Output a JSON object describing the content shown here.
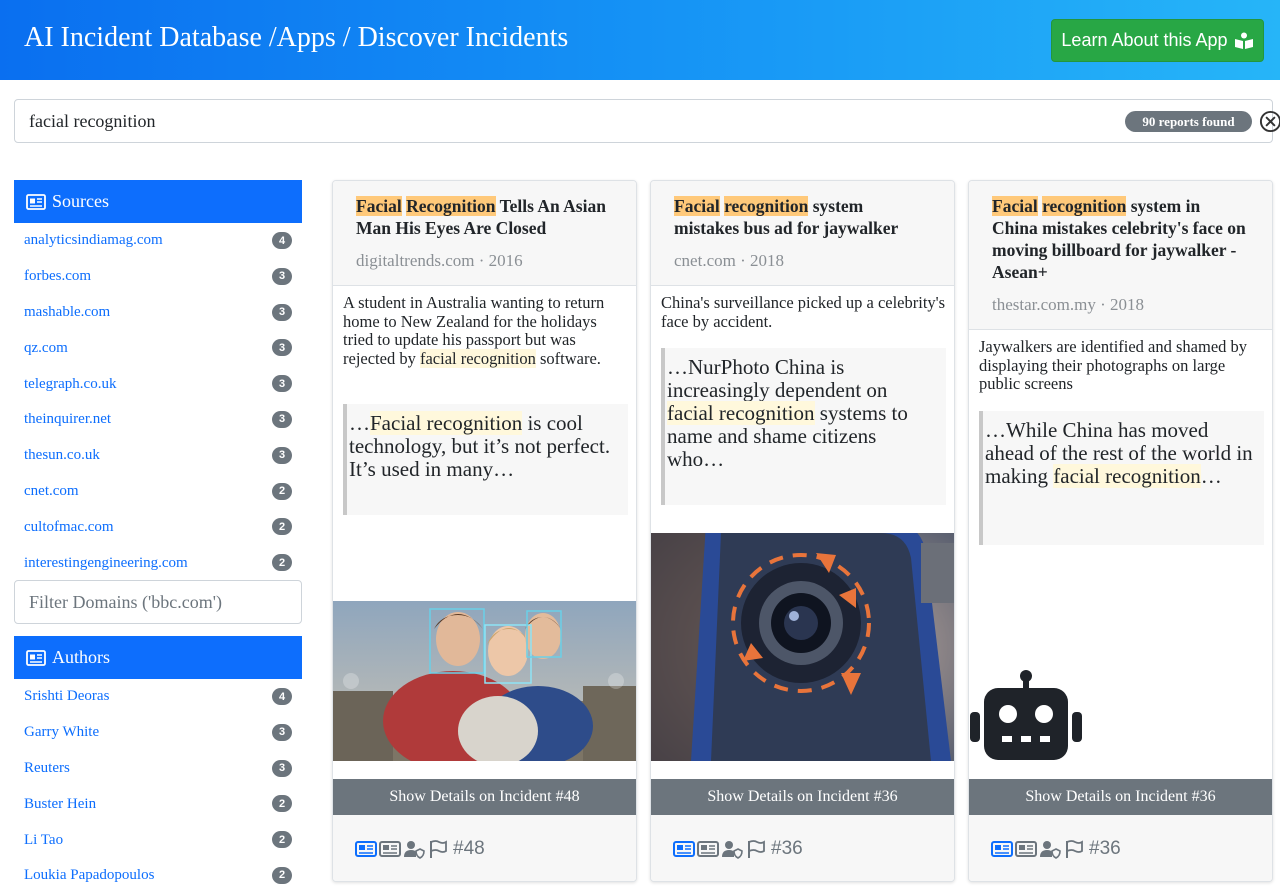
{
  "header": {
    "title": "AI Incident Database /Apps / Discover Incidents",
    "learn_button": "Learn About this App"
  },
  "search": {
    "value": "facial recognition",
    "results_badge": "90 reports found"
  },
  "sources": {
    "title": "Sources",
    "items": [
      {
        "name": "analyticsindiamag.com",
        "count": "4"
      },
      {
        "name": "forbes.com",
        "count": "3"
      },
      {
        "name": "mashable.com",
        "count": "3"
      },
      {
        "name": "qz.com",
        "count": "3"
      },
      {
        "name": "telegraph.co.uk",
        "count": "3"
      },
      {
        "name": "theinquirer.net",
        "count": "3"
      },
      {
        "name": "thesun.co.uk",
        "count": "3"
      },
      {
        "name": "cnet.com",
        "count": "2"
      },
      {
        "name": "cultofmac.com",
        "count": "2"
      },
      {
        "name": "interestingengineering.com",
        "count": "2"
      }
    ],
    "filter_placeholder": "Filter Domains ('bbc.com')"
  },
  "authors": {
    "title": "Authors",
    "items": [
      {
        "name": "Srishti Deoras",
        "count": "4"
      },
      {
        "name": "Garry White",
        "count": "3"
      },
      {
        "name": "Reuters",
        "count": "3"
      },
      {
        "name": "Buster Hein",
        "count": "2"
      },
      {
        "name": "Li Tao",
        "count": "2"
      },
      {
        "name": "Loukia Papadopoulos",
        "count": "2"
      }
    ]
  },
  "cards": [
    {
      "title_hl1": "Facial",
      "title_hl2": "Recognition",
      "title_rest": " Tells An Asian Man His Eyes Are Closed",
      "source": "digitaltrends.com · 2016",
      "desc_pre": "A student in Australia wanting to return home to New Zealand for the holidays tried to update his passport but was rejected by ",
      "desc_hl": "facial recognition",
      "desc_post": " software.",
      "quote_pre": "…",
      "quote_hl": "Facial recognition",
      "quote_post": " is cool technology, but it’s not perfect. It’s used in many…",
      "details": "Show Details on Incident #48",
      "incident": "#48"
    },
    {
      "title_hl1": "Facial",
      "title_hl2": "recognition",
      "title_rest": " system mistakes bus ad for jaywalker",
      "source": "cnet.com · 2018",
      "desc_pre": "China's surveillance picked up a celebrity's face by accident.",
      "quote_pre": "…NurPhoto China is increasingly dependent on ",
      "quote_hl": "facial recognition",
      "quote_post": " systems to name and shame citizens who…",
      "details": "Show Details on Incident #36",
      "incident": "#36"
    },
    {
      "title_hl1": "Facial",
      "title_hl2": "recognition",
      "title_rest": " system in China mistakes celebrity's face on moving billboard for jaywalker - Asean+",
      "source": "thestar.com.my · 2018",
      "desc_pre": "Jaywalkers are identified and shamed by displaying their photographs on large public screens",
      "quote_pre": "…While China has moved ahead of the rest of the world in making ",
      "quote_hl": "facial recognition",
      "quote_post": "…",
      "details": "Show Details on Incident #36",
      "incident": "#36"
    }
  ],
  "colors": {
    "header_start": "#0a6ff0",
    "header_end": "#26b5f8",
    "primary": "#0d6efd",
    "success": "#28a745",
    "secondary": "#6c757d",
    "highlight_strong": "#ffc97a",
    "highlight_soft": "#fff8dc"
  },
  "icons": {
    "learn_button": "book-reader-icon",
    "clear_search": "circle-x-icon",
    "facet_header": "id-card-icon",
    "card_footer": [
      "newspaper-icon",
      "id-card-icon",
      "user-shield-icon",
      "flag-icon",
      "hashtag-icon"
    ],
    "chatbot": "robot-icon"
  }
}
